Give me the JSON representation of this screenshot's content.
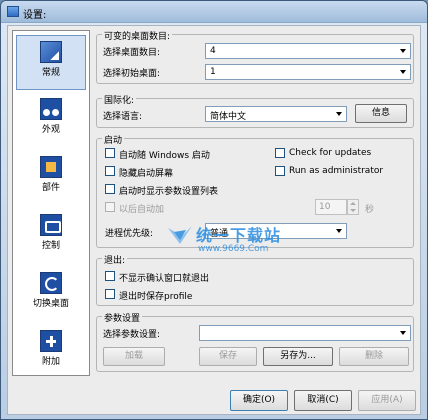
{
  "window": {
    "title": "设置:"
  },
  "nav": [
    {
      "label": "常规",
      "icon": "desktop-icon"
    },
    {
      "label": "外观",
      "icon": "appearance-icon"
    },
    {
      "label": "部件",
      "icon": "widgets-icon"
    },
    {
      "label": "控制",
      "icon": "control-icon"
    },
    {
      "label": "切换桌面",
      "icon": "switch-desktop-icon"
    },
    {
      "label": "附加",
      "icon": "addon-icon"
    }
  ],
  "desktops": {
    "title": "可变的桌面数目:",
    "count_label": "选择桌面数目:",
    "count_value": "4",
    "initial_label": "选择初始桌面:",
    "initial_value": "1"
  },
  "i18n": {
    "title": "国际化:",
    "lang_label": "选择语言:",
    "lang_value": "简体中文",
    "info_button": "信息"
  },
  "startup": {
    "title": "启动",
    "autostart": "自动随 Windows 启动",
    "check_updates": "Check for updates",
    "hide_splash": "隐藏启动屏幕",
    "run_admin": "Run as administrator",
    "show_list": "启动时显示参数设置列表",
    "delay_label": "以后自动加",
    "delay_value": "10",
    "seconds": "秒",
    "priority_label": "进程优先级:",
    "priority_value": "普通"
  },
  "exit": {
    "title": "退出:",
    "no_confirm": "不显示确认窗口就退出",
    "save_profile": "退出时保存profile"
  },
  "profile": {
    "title": "参数设置",
    "select_label": "选择参数设置:",
    "select_value": "",
    "load": "加载",
    "save": "保存",
    "save_as": "另存为...",
    "delete": "删除"
  },
  "footer": {
    "ok": "确定(O)",
    "cancel": "取消(C)",
    "apply": "应用(A)"
  },
  "watermark": {
    "text": "统一下载站",
    "url": "www.9669.Com"
  }
}
